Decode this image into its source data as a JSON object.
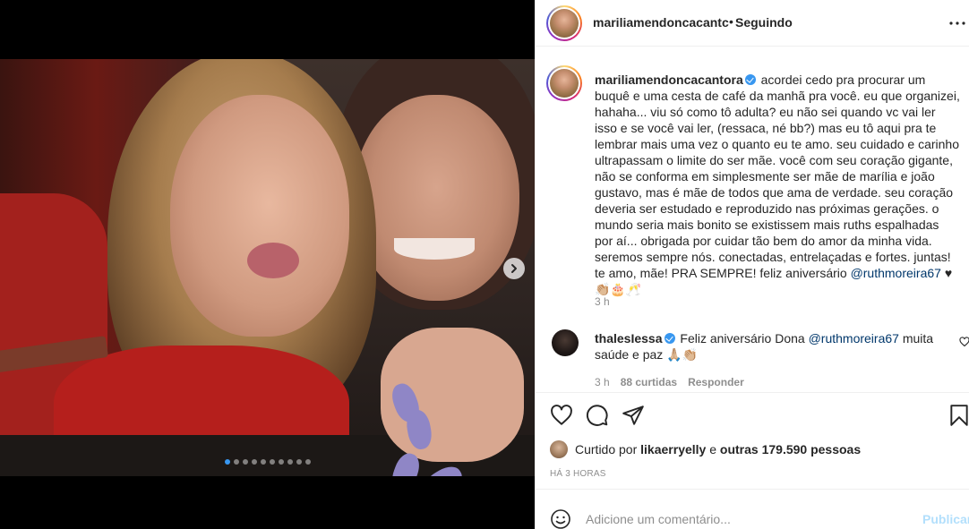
{
  "post": {
    "author": "mariliamendoncacantc",
    "separator": "•",
    "follow_status": "Seguindo"
  },
  "caption": {
    "username": "mariliamendoncacantora",
    "text_before": "acordei cedo pra procurar um buquê e uma cesta de café da manhã pra você. eu que organizei, hahaha... viu só como tô adulta? eu não sei quando vc vai ler isso e se você vai ler, (ressaca, né bb?) mas eu tô aqui pra te lembrar mais uma vez o quanto eu te amo. seu cuidado e carinho ultrapassam o limite do ser mãe. você com seu coração gigante, não se conforma em simplesmente ser mãe de marília e joão gustavo, mas é mãe de todos que ama de verdade. seu coração deveria ser estudado e reproduzido nas próximas gerações. o mundo seria mais bonito se existissem mais ruths espalhadas por aí... obrigada por cuidar tão bem do amor da minha vida. seremos sempre nós. conectadas, entrelaçadas e fortes. juntas! te amo, mãe! PRA SEMPRE! feliz aniversário",
    "mention": "@ruthmoreira67",
    "emoji": "♥ 👏🏼🎂🥂",
    "time": "3 h"
  },
  "comment": {
    "username": "thalesIessa",
    "text_before": "Feliz aniversário Dona",
    "mention": "@ruthmoreira67",
    "text_after": "muita saúde e paz 🙏🏼👏🏼",
    "time": "3 h",
    "likes": "88 curtidas",
    "reply_label": "Responder"
  },
  "likes": {
    "prefix": "Curtido por",
    "user": "likaerryelly",
    "middle": "e",
    "others": "outras 179.590 pessoas"
  },
  "timestamp": "HÁ 3 HORAS",
  "comment_box": {
    "placeholder": "Adicione um comentário...",
    "publish_label": "Publicar"
  },
  "carousel": {
    "total": 10,
    "active_index": 0
  },
  "colors": {
    "accent": "#3897f0",
    "publish_disabled": "#b2dffc",
    "mention": "#00376b"
  },
  "icons": [
    "next-arrow-icon",
    "more-icon",
    "heart-icon",
    "comment-icon",
    "share-icon",
    "bookmark-icon",
    "emoji-icon",
    "verified-icon",
    "comment-like-icon"
  ]
}
